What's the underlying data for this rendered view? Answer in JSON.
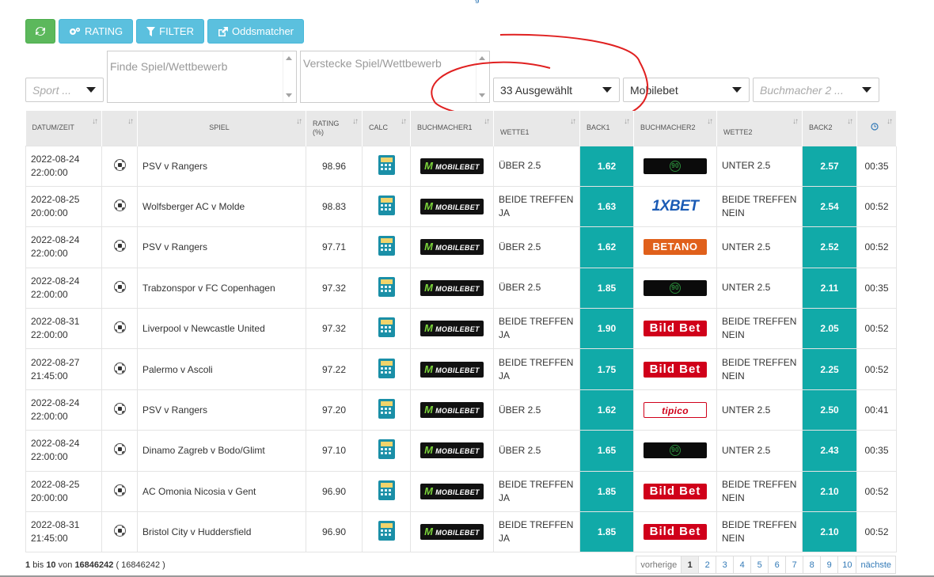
{
  "top_link": "g",
  "toolbar": {
    "refresh_label": "",
    "rating_label": "RATING",
    "filter_label": "FILTER",
    "oddsmatcher_label": "Oddsmatcher"
  },
  "filters": {
    "sport_placeholder": "Sport ...",
    "find_placeholder": "Finde Spiel/Wettbewerb",
    "hide_placeholder": "Verstecke Spiel/Wettbewerb",
    "selected_label": "33 Ausgewählt",
    "bookmaker1": "Mobilebet",
    "bookmaker2_placeholder": "Buchmacher 2 ..."
  },
  "columns": [
    "DATUM/ZEIT",
    "",
    "SPIEL",
    "RATING (%)",
    "CALC",
    "BUCHMACHER1",
    "WETTE1",
    "BACK1",
    "BUCHMACHER2",
    "WETTE2",
    "BACK2",
    ""
  ],
  "rows": [
    {
      "date": "2022-08-24",
      "time": "22:00:00",
      "match": "PSV v Rangers",
      "rating": "98.96",
      "bm1": "MOBILEBET",
      "bet1": "ÜBER 2.5",
      "back1": "1.62",
      "bm2": "90",
      "bm2_type": "b90",
      "bet2": "UNTER 2.5",
      "back2": "2.57",
      "age": "00:35"
    },
    {
      "date": "2022-08-25",
      "time": "20:00:00",
      "match": "Wolfsberger AC v Molde",
      "rating": "98.83",
      "bm1": "MOBILEBET",
      "bet1": "BEIDE TREFFEN JA",
      "back1": "1.63",
      "bm2": "1XBET",
      "bm2_type": "xbet",
      "bet2": "BEIDE TREFFEN NEIN",
      "back2": "2.54",
      "age": "00:52"
    },
    {
      "date": "2022-08-24",
      "time": "22:00:00",
      "match": "PSV v Rangers",
      "rating": "97.71",
      "bm1": "MOBILEBET",
      "bet1": "ÜBER 2.5",
      "back1": "1.62",
      "bm2": "BETANO",
      "bm2_type": "betano",
      "bet2": "UNTER 2.5",
      "back2": "2.52",
      "age": "00:52"
    },
    {
      "date": "2022-08-24",
      "time": "22:00:00",
      "match": "Trabzonspor v FC Copenhagen",
      "rating": "97.32",
      "bm1": "MOBILEBET",
      "bet1": "ÜBER 2.5",
      "back1": "1.85",
      "bm2": "90",
      "bm2_type": "b90",
      "bet2": "UNTER 2.5",
      "back2": "2.11",
      "age": "00:35"
    },
    {
      "date": "2022-08-31",
      "time": "22:00:00",
      "match": "Liverpool v Newcastle United",
      "rating": "97.32",
      "bm1": "MOBILEBET",
      "bet1": "BEIDE TREFFEN JA",
      "back1": "1.90",
      "bm2": "Bild Bet",
      "bm2_type": "bild",
      "bet2": "BEIDE TREFFEN NEIN",
      "back2": "2.05",
      "age": "00:52"
    },
    {
      "date": "2022-08-27",
      "time": "21:45:00",
      "match": "Palermo v Ascoli",
      "rating": "97.22",
      "bm1": "MOBILEBET",
      "bet1": "BEIDE TREFFEN JA",
      "back1": "1.75",
      "bm2": "Bild Bet",
      "bm2_type": "bild",
      "bet2": "BEIDE TREFFEN NEIN",
      "back2": "2.25",
      "age": "00:52"
    },
    {
      "date": "2022-08-24",
      "time": "22:00:00",
      "match": "PSV v Rangers",
      "rating": "97.20",
      "bm1": "MOBILEBET",
      "bet1": "ÜBER 2.5",
      "back1": "1.62",
      "bm2": "tipico",
      "bm2_type": "tipico",
      "bet2": "UNTER 2.5",
      "back2": "2.50",
      "age": "00:41"
    },
    {
      "date": "2022-08-24",
      "time": "22:00:00",
      "match": "Dinamo Zagreb v Bodo/Glimt",
      "rating": "97.10",
      "bm1": "MOBILEBET",
      "bet1": "ÜBER 2.5",
      "back1": "1.65",
      "bm2": "90",
      "bm2_type": "b90",
      "bet2": "UNTER 2.5",
      "back2": "2.43",
      "age": "00:35"
    },
    {
      "date": "2022-08-25",
      "time": "20:00:00",
      "match": "AC Omonia Nicosia v Gent",
      "rating": "96.90",
      "bm1": "MOBILEBET",
      "bet1": "BEIDE TREFFEN JA",
      "back1": "1.85",
      "bm2": "Bild Bet",
      "bm2_type": "bild",
      "bet2": "BEIDE TREFFEN NEIN",
      "back2": "2.10",
      "age": "00:52"
    },
    {
      "date": "2022-08-31",
      "time": "21:45:00",
      "match": "Bristol City v Huddersfield",
      "rating": "96.90",
      "bm1": "MOBILEBET",
      "bet1": "BEIDE TREFFEN JA",
      "back1": "1.85",
      "bm2": "Bild Bet",
      "bm2_type": "bild",
      "bet2": "BEIDE TREFFEN NEIN",
      "back2": "2.10",
      "age": "00:52"
    }
  ],
  "footer": {
    "from": "1",
    "word_bis": "bis",
    "to": "10",
    "word_von": "von",
    "total": "16846242",
    "total_paren": "( 16846242 )"
  },
  "pager": {
    "prev": "vorherige",
    "pages": [
      "1",
      "2",
      "3",
      "4",
      "5",
      "6",
      "7",
      "8",
      "9",
      "10"
    ],
    "next": "nächste"
  },
  "colors": {
    "accent": "#11aaa8",
    "annotation": "#e02020"
  }
}
